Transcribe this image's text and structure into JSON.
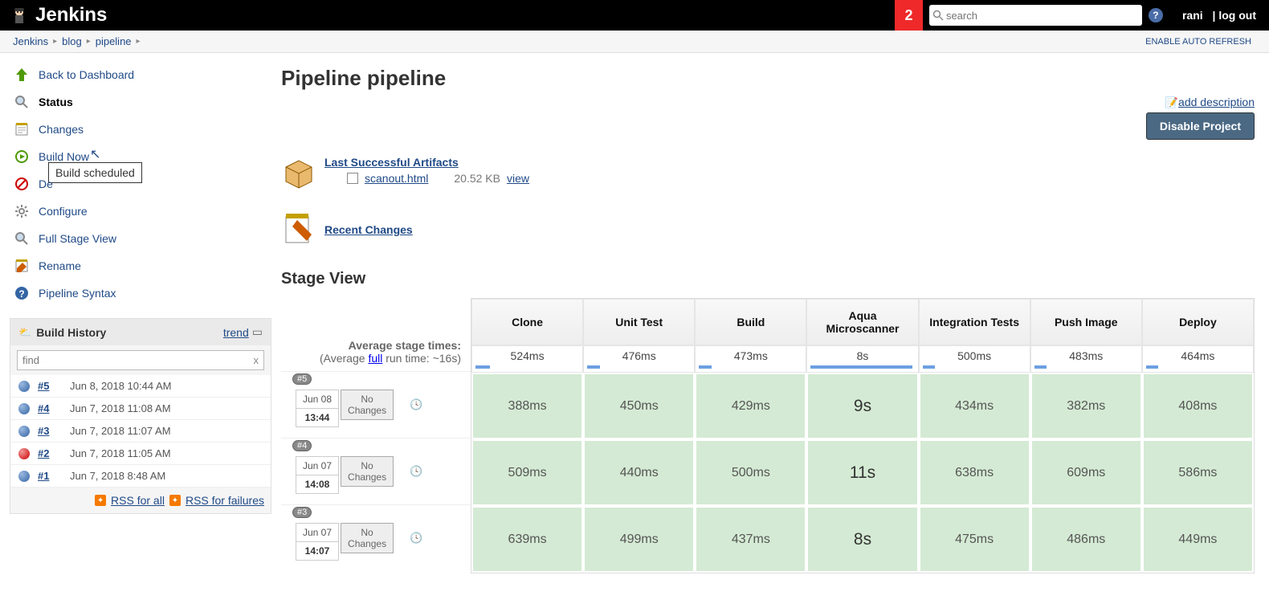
{
  "header": {
    "logo_text": "Jenkins",
    "notif_count": "2",
    "search_placeholder": "search",
    "username": "rani",
    "logout": "| log out"
  },
  "breadcrumbs": {
    "items": [
      "Jenkins",
      "blog",
      "pipeline"
    ],
    "auto_refresh": "ENABLE AUTO REFRESH"
  },
  "sidebar": {
    "nav": {
      "back": "Back to Dashboard",
      "status": "Status",
      "changes": "Changes",
      "build_now": "Build Now",
      "delete": "De",
      "delete_tooltip": "Build scheduled",
      "configure": "Configure",
      "full_stage": "Full Stage View",
      "rename": "Rename",
      "syntax": "Pipeline Syntax"
    },
    "build_history": {
      "title": "Build History",
      "trend": "trend",
      "find_placeholder": "find",
      "clear": "x",
      "rows": [
        {
          "num": "#5",
          "date": "Jun 8, 2018 10:44 AM",
          "status": "blue"
        },
        {
          "num": "#4",
          "date": "Jun 7, 2018 11:08 AM",
          "status": "blue"
        },
        {
          "num": "#3",
          "date": "Jun 7, 2018 11:07 AM",
          "status": "blue"
        },
        {
          "num": "#2",
          "date": "Jun 7, 2018 11:05 AM",
          "status": "red"
        },
        {
          "num": "#1",
          "date": "Jun 7, 2018 8:48 AM",
          "status": "blue"
        }
      ],
      "rss_all": "RSS for all",
      "rss_fail": "RSS for failures"
    }
  },
  "main": {
    "title": "Pipeline pipeline",
    "add_desc": "add description",
    "disable": "Disable Project",
    "artifacts": {
      "title": "Last Successful Artifacts",
      "file": "scanout.html",
      "size": "20.52 KB",
      "view": "view"
    },
    "recent_changes": "Recent Changes",
    "stage_title": "Stage View",
    "avg_label": "Average stage times:",
    "avg_full_prefix": "(Average ",
    "avg_full_link": "full",
    "avg_full_suffix": " run time: ~16s)",
    "stages": {
      "headers": [
        "Clone",
        "Unit Test",
        "Build",
        "Aqua Microscanner",
        "Integration Tests",
        "Push Image",
        "Deploy"
      ],
      "avgs": [
        "524ms",
        "476ms",
        "473ms",
        "8s",
        "500ms",
        "483ms",
        "464ms"
      ],
      "avg_bars": [
        14,
        12,
        12,
        98,
        12,
        12,
        12
      ],
      "runs": [
        {
          "badge": "#5",
          "date": "Jun 08",
          "time": "13:44",
          "changes": "No Changes",
          "row": [
            "388ms",
            "450ms",
            "429ms",
            "9s",
            "434ms",
            "382ms",
            "408ms"
          ]
        },
        {
          "badge": "#4",
          "date": "Jun 07",
          "time": "14:08",
          "changes": "No Changes",
          "row": [
            "509ms",
            "440ms",
            "500ms",
            "11s",
            "638ms",
            "609ms",
            "586ms"
          ]
        },
        {
          "badge": "#3",
          "date": "Jun 07",
          "time": "14:07",
          "changes": "No Changes",
          "row": [
            "639ms",
            "499ms",
            "437ms",
            "8s",
            "475ms",
            "486ms",
            "449ms"
          ]
        }
      ]
    }
  }
}
